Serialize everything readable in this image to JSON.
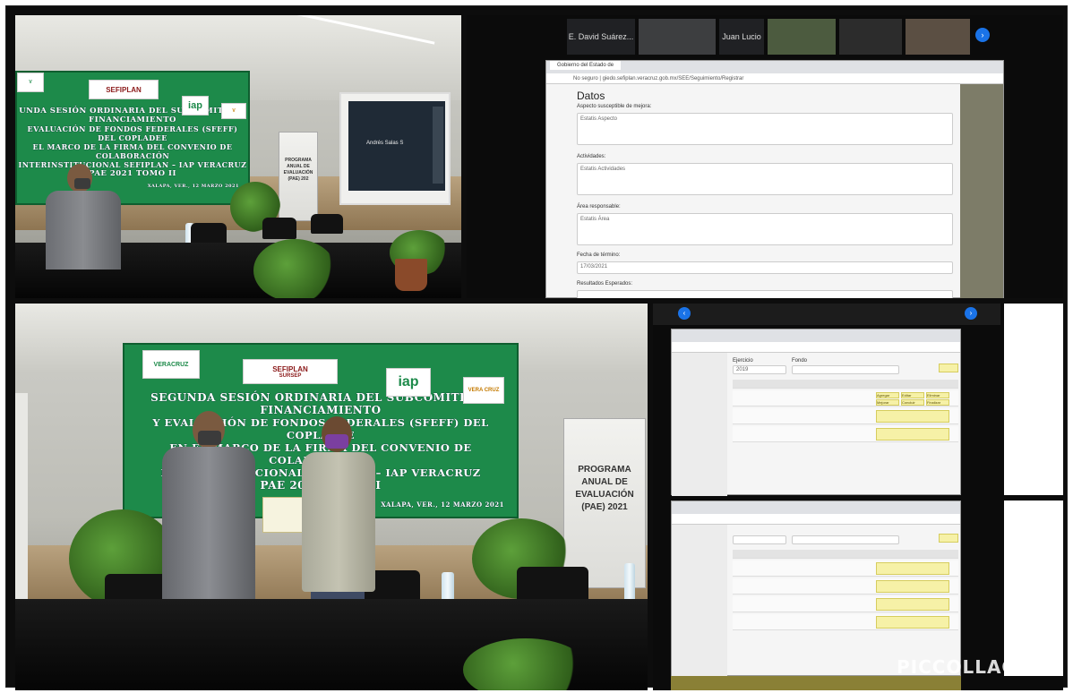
{
  "panel_top_left": {
    "banner_lines": [
      "UNDA SESIÓN ORDINARIA DEL SUBCOMITÉ DE FINANCIAMIENTO",
      "EVALUACIÓN DE FONDOS FEDERALES (SFEFF) DEL COPLADEE",
      "EL MARCO DE LA FIRMA DEL CONVENIO DE COLABORACIÓN",
      "INTERINSTITUCIONAL SEFIPLAN – IAP VERACRUZ",
      "PAE 2021 TOMO II"
    ],
    "banner_footer": "XALAPA, VER., 12 MARZO 2021",
    "logo_sefiplan": "SEFIPLAN",
    "logo_iap": "iap",
    "sign_lines": [
      "PROGRAMA",
      "ANUAL DE",
      "EVALUACIÓN",
      "(PAE) 202"
    ],
    "projector_name": "Andrés Salas S"
  },
  "panel_top_right": {
    "participants": [
      "E. David Suárez...",
      "Juan Lucio"
    ],
    "tab_label": "Gobierno del Estado de",
    "url": "No seguro | giedo.sefiplan.veracruz.gob.mx/SEE/Seguimiento/Registrar",
    "page_title": "Datos",
    "fields": [
      {
        "label": "Aspecto susceptible de mejora:",
        "value": "Estatis Aspecto"
      },
      {
        "label": "Actividades:",
        "value": "Estatis Actividades"
      },
      {
        "label": "Área responsable:",
        "value": "Estatis Área"
      },
      {
        "label": "Fecha de término:",
        "value": "17/03/2021"
      },
      {
        "label": "Resultados Esperados:",
        "value": ""
      }
    ]
  },
  "panel_bottom_left": {
    "logo_veracruz": "VERACRUZ",
    "logo_sefiplan": "SEFIPLAN",
    "logo_sursep": "SURSEP",
    "logo_iap": "iap",
    "logo_veracruz2": "VERA CRUZ",
    "banner_lines": [
      "SEGUNDA SESIÓN ORDINARIA DEL SUBCOMITÉ DE FINANCIAMIENTO",
      "Y EVALUACIÓN DE FONDOS FEDERALES (SFEFF) DEL COPLADEE",
      "EN EL MARCO DE LA FIRMA DEL CONVENIO DE COLABORACIÓN",
      "INTERINSTITUCIONAL SEFIPLAN – IAP VERACRUZ",
      "PAE 2021 TOMO II"
    ],
    "banner_footer": "XALAPA, VER., 12 MARZO 2021",
    "sign_lines": [
      "PROGRAMA",
      "ANUAL DE",
      "EVALUACIÓN",
      "(PAE) 2021"
    ]
  },
  "panel_bottom_right": {
    "top_labels": [
      "Ejercicio",
      "Fondo"
    ],
    "ejercicio": "2019",
    "row_buttons": [
      "Agregar",
      "Editar",
      "Eliminar",
      "Mejorar",
      "Concluir",
      "Finalizar"
    ],
    "watermark": "PICCOLLAGE"
  },
  "colors": {
    "banner_green": "#1d8a4a",
    "frame": "#0d0d0d",
    "button_yellow": "#f6f1a7"
  }
}
